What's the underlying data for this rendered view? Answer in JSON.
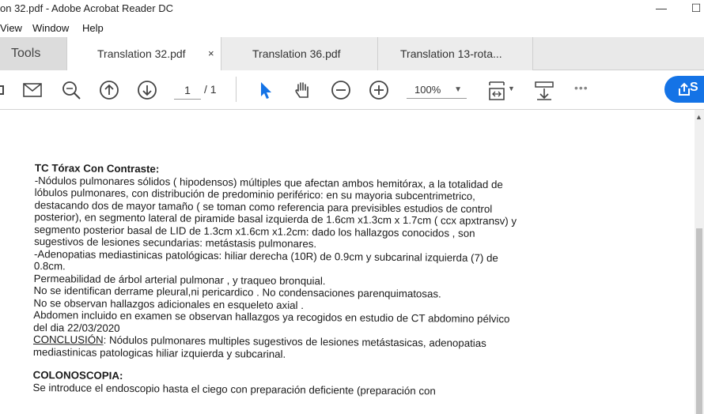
{
  "window": {
    "title": "on 32.pdf - Adobe Acrobat Reader DC",
    "minimize": "—",
    "maximize": "☐"
  },
  "menu": [
    "View",
    "Window",
    "Help"
  ],
  "tabs": {
    "tools": "Tools",
    "active": "Translation 32.pdf",
    "active_close": "×",
    "second": "Translation 36.pdf",
    "third": "Translation 13-rota..."
  },
  "toolbar": {
    "page_current": "1",
    "page_total": "/ 1",
    "zoom": "100%",
    "zoom_arrow": "▼",
    "more": "•••"
  },
  "icons": [
    "email-icon",
    "zoom-search-icon",
    "page-up-icon",
    "page-down-icon",
    "select-cursor-icon",
    "hand-tool-icon",
    "zoom-out-icon",
    "zoom-in-icon",
    "fit-page-icon",
    "scroll-mode-icon",
    "more-icon",
    "share-icon"
  ],
  "document": {
    "tc_heading": "TC Tórax Con Contraste:",
    "tc_lines": [
      "-Nódulos pulmonares sólidos ( hipodensos) múltiples que afectan ambos hemitórax, a la totalidad de",
      "lóbulos pulmonares, con distribución de predominio periférico: en su mayoria subcentrimetrico,",
      "destacando dos de mayor tamaño ( se toman como referencia para previsibles estudios de control",
      "posterior), en segmento lateral de piramide basal izquierda de 1.6cm x1.3cm x 1.7cm ( ccx apxtransv) y",
      "segmento posterior basal de LID de 1.3cm x1.6cm x1.2cm: dado los hallazgos conocidos , son",
      "sugestivos de lesiones secundarias: metástasis pulmonares.",
      "-Adenopatias mediastinicas patológicas: hiliar derecha (10R) de 0.9cm y subcarinal izquierda (7) de",
      "0.8cm.",
      "Permeabilidad de árbol arterial pulmonar , y traqueo bronquial.",
      "No se identifican derrame pleural,ni pericardico . No condensaciones parenquimatosas.",
      "No se observan hallazgos adicionales en esqueleto axial .",
      "Abdomen incluido en examen se observan hallazgos ya recogidos en estudio de CT abdomino pélvico",
      "del dia 22/03/2020"
    ],
    "conclusion_label": "CONCLUSIÓN",
    "conclusion_text": ": Nódulos pulmonares multiples sugestivos de lesiones metástasicas, adenopatias",
    "conclusion_line2": "mediastinicas patologicas hiliar izquierda y subcarinal.",
    "colon_heading": "COLONOSCOPIA:",
    "colon_line": "Se introduce el endoscopio hasta el ciego con preparación deficiente (preparación con"
  },
  "colors": {
    "accent": "#1473e6",
    "tab_bg": "#e9e9e9",
    "active_tab": "#ffffff",
    "scroll_thumb": "#c2c2c2"
  }
}
